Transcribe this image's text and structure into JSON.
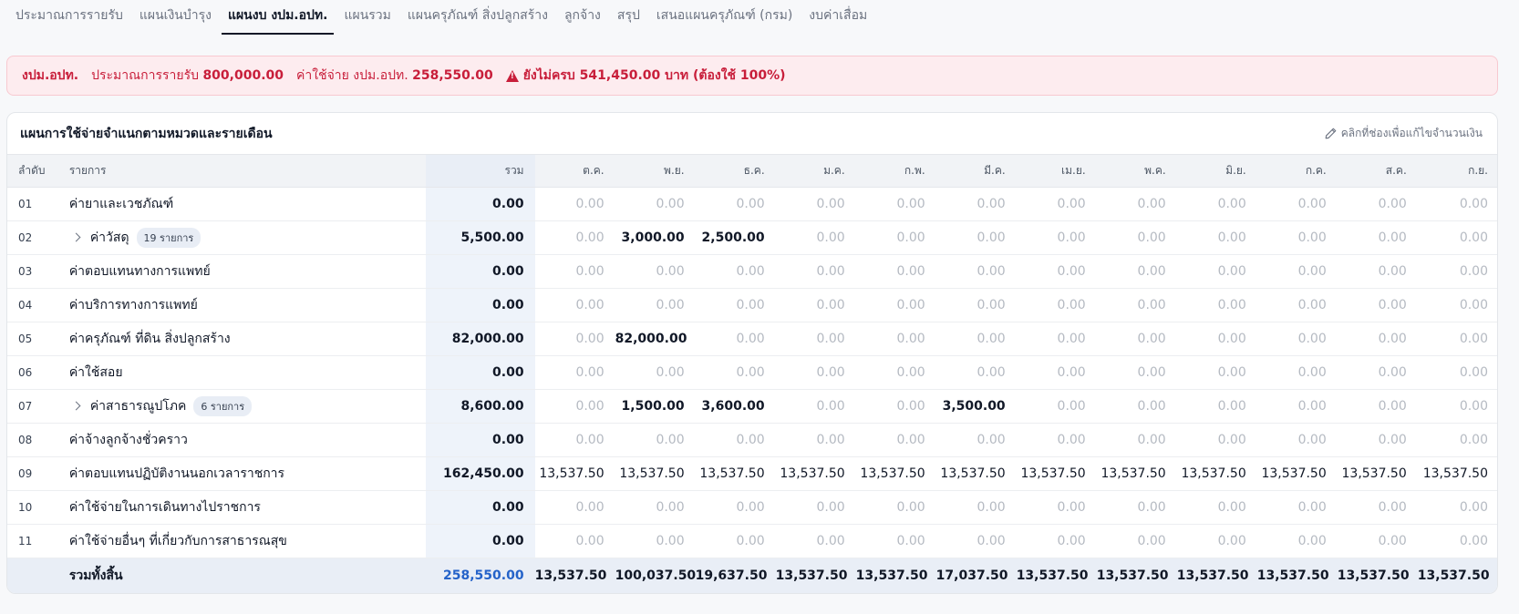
{
  "tabs": [
    {
      "label": "ประมาณการรายรับ",
      "active": false
    },
    {
      "label": "แผนเงินบำรุง",
      "active": false
    },
    {
      "label": "แผนงบ งปม.อปท.",
      "active": true
    },
    {
      "label": "แผนรวม",
      "active": false
    },
    {
      "label": "แผนครุภัณฑ์ สิ่งปลูกสร้าง",
      "active": false
    },
    {
      "label": "ลูกจ้าง",
      "active": false
    },
    {
      "label": "สรุป",
      "active": false
    },
    {
      "label": "เสนอแผนครุภัณฑ์ (กรม)",
      "active": false
    },
    {
      "label": "งบค่าเสื่อม",
      "active": false
    }
  ],
  "alert": {
    "source": "งปม.อปท.",
    "revenue_label": "ประมาณการรายรับ",
    "revenue_value": "800,000.00",
    "expense_label": "ค่าใช้จ่าย งปม.อปท.",
    "expense_value": "258,550.00",
    "warning": "ยังไม่ครบ 541,450.00 บาท (ต้องใช้ 100%)",
    "color": "#c81e3a"
  },
  "card": {
    "title": "แผนการใช้จ่ายจำแนกตามหมวดและรายเดือน",
    "hint": "คลิกที่ช่องเพื่อแก้ไขจำนวนเงิน"
  },
  "table": {
    "headers": {
      "no": "ลำดับ",
      "item": "รายการ",
      "total": "รวม",
      "months": [
        "ต.ค.",
        "พ.ย.",
        "ธ.ค.",
        "ม.ค.",
        "ก.พ.",
        "มี.ค.",
        "เม.ย.",
        "พ.ค.",
        "มิ.ย.",
        "ก.ค.",
        "ส.ค.",
        "ก.ย."
      ]
    },
    "rows": [
      {
        "no": "01",
        "name": "ค่ายาและเวชภัณฑ์",
        "expandable": false,
        "badge": "",
        "total": "0.00",
        "months": [
          "0.00",
          "0.00",
          "0.00",
          "0.00",
          "0.00",
          "0.00",
          "0.00",
          "0.00",
          "0.00",
          "0.00",
          "0.00",
          "0.00"
        ]
      },
      {
        "no": "02",
        "name": "ค่าวัสดุ",
        "expandable": true,
        "badge": "19 รายการ",
        "total": "5,500.00",
        "months": [
          "0.00",
          "3,000.00",
          "2,500.00",
          "0.00",
          "0.00",
          "0.00",
          "0.00",
          "0.00",
          "0.00",
          "0.00",
          "0.00",
          "0.00"
        ]
      },
      {
        "no": "03",
        "name": "ค่าตอบแทนทางการแพทย์",
        "expandable": false,
        "badge": "",
        "total": "0.00",
        "months": [
          "0.00",
          "0.00",
          "0.00",
          "0.00",
          "0.00",
          "0.00",
          "0.00",
          "0.00",
          "0.00",
          "0.00",
          "0.00",
          "0.00"
        ]
      },
      {
        "no": "04",
        "name": "ค่าบริการทางการแพทย์",
        "expandable": false,
        "badge": "",
        "total": "0.00",
        "months": [
          "0.00",
          "0.00",
          "0.00",
          "0.00",
          "0.00",
          "0.00",
          "0.00",
          "0.00",
          "0.00",
          "0.00",
          "0.00",
          "0.00"
        ]
      },
      {
        "no": "05",
        "name": "ค่าครุภัณฑ์ ที่ดิน สิ่งปลูกสร้าง",
        "expandable": false,
        "badge": "",
        "total": "82,000.00",
        "months": [
          "0.00",
          "82,000.00",
          "0.00",
          "0.00",
          "0.00",
          "0.00",
          "0.00",
          "0.00",
          "0.00",
          "0.00",
          "0.00",
          "0.00"
        ]
      },
      {
        "no": "06",
        "name": "ค่าใช้สอย",
        "expandable": false,
        "badge": "",
        "total": "0.00",
        "months": [
          "0.00",
          "0.00",
          "0.00",
          "0.00",
          "0.00",
          "0.00",
          "0.00",
          "0.00",
          "0.00",
          "0.00",
          "0.00",
          "0.00"
        ]
      },
      {
        "no": "07",
        "name": "ค่าสาธารณูปโภค",
        "expandable": true,
        "badge": "6 รายการ",
        "total": "8,600.00",
        "months": [
          "0.00",
          "1,500.00",
          "3,600.00",
          "0.00",
          "0.00",
          "3,500.00",
          "0.00",
          "0.00",
          "0.00",
          "0.00",
          "0.00",
          "0.00"
        ]
      },
      {
        "no": "08",
        "name": "ค่าจ้างลูกจ้างชั่วคราว",
        "expandable": false,
        "badge": "",
        "total": "0.00",
        "months": [
          "0.00",
          "0.00",
          "0.00",
          "0.00",
          "0.00",
          "0.00",
          "0.00",
          "0.00",
          "0.00",
          "0.00",
          "0.00",
          "0.00"
        ]
      },
      {
        "no": "09",
        "name": "ค่าตอบแทนปฏิบัติงานนอกเวลาราชการ",
        "expandable": false,
        "badge": "",
        "total": "162,450.00",
        "months": [
          "13,537.50",
          "13,537.50",
          "13,537.50",
          "13,537.50",
          "13,537.50",
          "13,537.50",
          "13,537.50",
          "13,537.50",
          "13,537.50",
          "13,537.50",
          "13,537.50",
          "13,537.50"
        ]
      },
      {
        "no": "10",
        "name": "ค่าใช้จ่ายในการเดินทางไปราชการ",
        "expandable": false,
        "badge": "",
        "total": "0.00",
        "months": [
          "0.00",
          "0.00",
          "0.00",
          "0.00",
          "0.00",
          "0.00",
          "0.00",
          "0.00",
          "0.00",
          "0.00",
          "0.00",
          "0.00"
        ]
      },
      {
        "no": "11",
        "name": "ค่าใช้จ่ายอื่นๆ ที่เกี่ยวกับการสาธารณสุข",
        "expandable": false,
        "badge": "",
        "total": "0.00",
        "months": [
          "0.00",
          "0.00",
          "0.00",
          "0.00",
          "0.00",
          "0.00",
          "0.00",
          "0.00",
          "0.00",
          "0.00",
          "0.00",
          "0.00"
        ]
      }
    ],
    "footer": {
      "label": "รวมทั้งสิ้น",
      "total": "258,550.00",
      "months": [
        "13,537.50",
        "100,037.50",
        "19,637.50",
        "13,537.50",
        "13,537.50",
        "17,037.50",
        "13,537.50",
        "13,537.50",
        "13,537.50",
        "13,537.50",
        "13,537.50",
        "13,537.50"
      ]
    }
  }
}
